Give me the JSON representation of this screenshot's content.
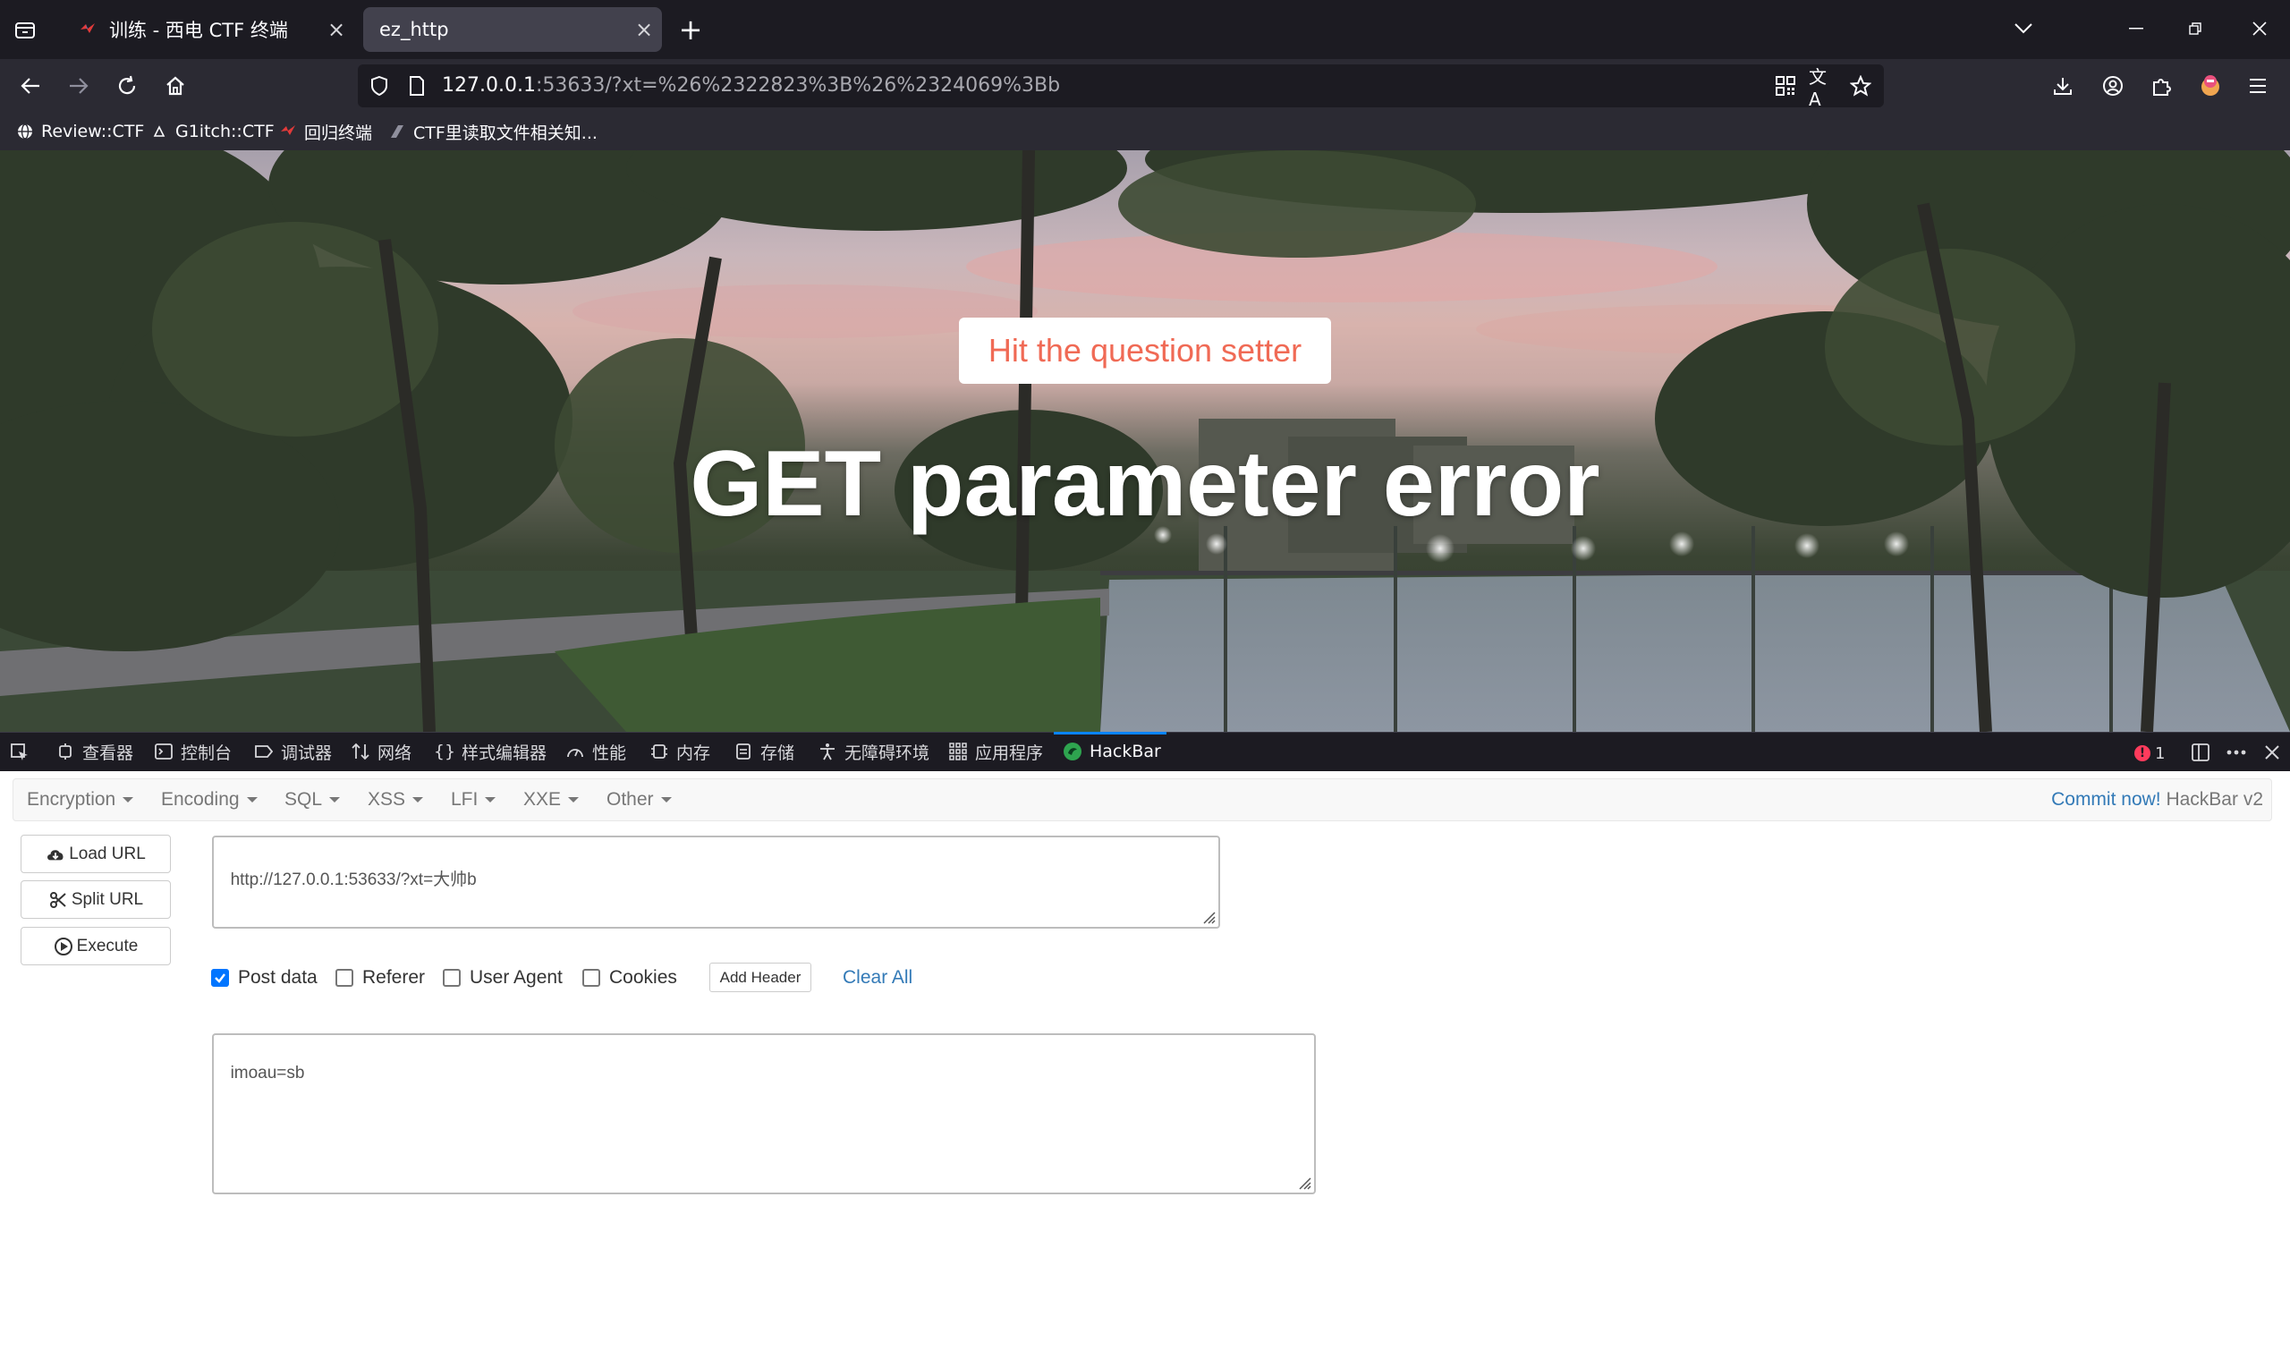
{
  "tabs": [
    {
      "title": "训练 - 西电 CTF 终端",
      "active": false
    },
    {
      "title": "ez_http",
      "active": true
    }
  ],
  "address": {
    "host": "127.0.0.1",
    "rest": ":53633/?xt=%26%2322823%3B%26%2324069%3Bb"
  },
  "bookmarks": [
    "Review::CTF",
    "G1itch::CTF",
    "回归终端",
    "CTF里读取文件相关知..."
  ],
  "page": {
    "button_label": "Hit the question setter",
    "heading": "GET parameter error"
  },
  "devtools": {
    "tabs": [
      "查看器",
      "控制台",
      "调试器",
      "网络",
      "样式编辑器",
      "性能",
      "内存",
      "存储",
      "无障碍环境",
      "应用程序",
      "HackBar"
    ],
    "error_count": "1"
  },
  "hackbar": {
    "menus": [
      "Encryption",
      "Encoding",
      "SQL",
      "XSS",
      "LFI",
      "XXE",
      "Other"
    ],
    "commit_link": "Commit now!",
    "commit_suffix": " HackBar v2",
    "buttons": {
      "load": "Load URL",
      "split": "Split URL",
      "execute": "Execute"
    },
    "url_value": "http://127.0.0.1:53633/?xt=大帅b",
    "options": [
      {
        "label": "Post data",
        "checked": true
      },
      {
        "label": "Referer",
        "checked": false
      },
      {
        "label": "User Agent",
        "checked": false
      },
      {
        "label": "Cookies",
        "checked": false
      }
    ],
    "add_header": "Add Header",
    "clear_all": "Clear All",
    "post_value": "imoau=sb"
  },
  "colors": {
    "chrome_dark": "#1c1b22",
    "chrome_mid": "#2b2a33",
    "accent": "#0a84ff",
    "setter_text": "#f06a55",
    "link": "#337ab7"
  }
}
